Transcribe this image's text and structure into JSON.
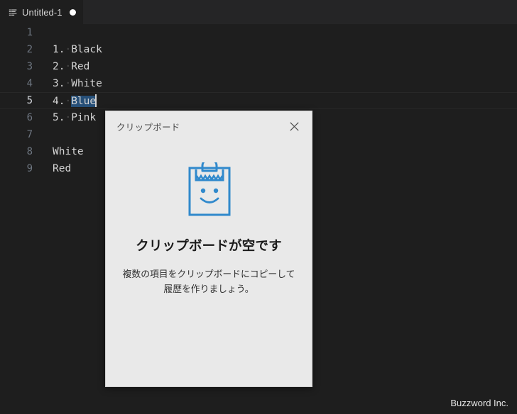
{
  "window": {
    "background_color": "#1e1e1e",
    "watermark": "Buzzword Inc."
  },
  "tabbar": {
    "background_color": "#252526",
    "tabs": [
      {
        "label": "Untitled-1",
        "icon": "file-lines-icon",
        "dirty": true,
        "active": true
      }
    ]
  },
  "editor": {
    "language_font": "monospace",
    "active_line": 5,
    "selection": {
      "line": 5,
      "text": "Blue"
    },
    "lines": [
      {
        "number": "1",
        "prefix": "",
        "dot": "",
        "text": ""
      },
      {
        "number": "2",
        "prefix": "1.",
        "dot": "·",
        "text": "Black"
      },
      {
        "number": "3",
        "prefix": "2.",
        "dot": "·",
        "text": "Red"
      },
      {
        "number": "4",
        "prefix": "3.",
        "dot": "·",
        "text": "White"
      },
      {
        "number": "5",
        "prefix": "4.",
        "dot": "·",
        "text": "Blue"
      },
      {
        "number": "6",
        "prefix": "5.",
        "dot": "·",
        "text": "Pink"
      },
      {
        "number": "7",
        "prefix": "",
        "dot": "",
        "text": ""
      },
      {
        "number": "8",
        "prefix": "",
        "dot": "",
        "text": "White"
      },
      {
        "number": "9",
        "prefix": "",
        "dot": "",
        "text": "Red"
      }
    ]
  },
  "clipboard_panel": {
    "title": "クリップボード",
    "close_icon": "close-icon",
    "illustration_icon": "clipboard-smiley-icon",
    "illustration_color": "#3089cc",
    "empty_heading": "クリップボードが空です",
    "empty_description": "複数の項目をクリップボードにコピーして履歴を作りましょう。",
    "background_color": "#e9e9e9"
  }
}
